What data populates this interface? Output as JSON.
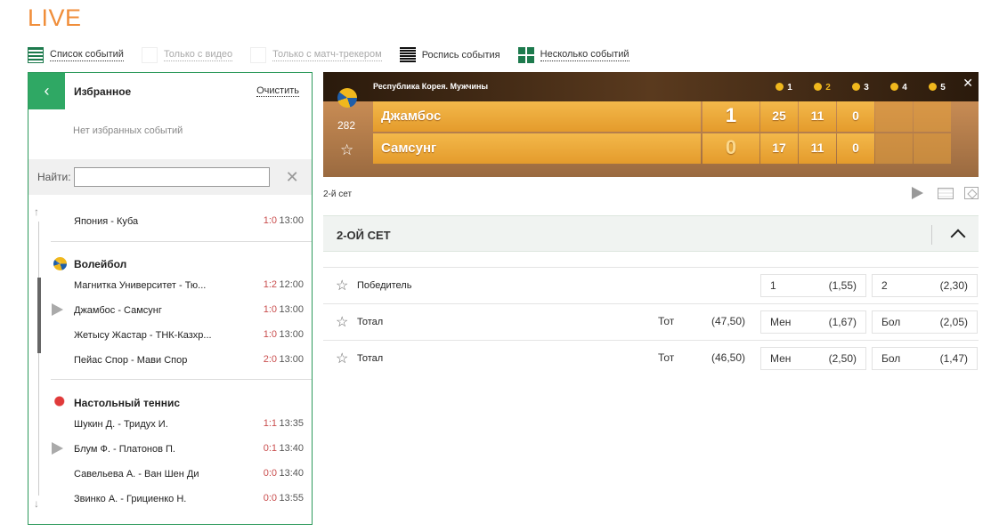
{
  "page_title": "LIVE",
  "view_options": [
    {
      "label": "Список событий",
      "icon": "list-icon"
    },
    {
      "label": "Только с видео",
      "icon": "video-filter-icon"
    },
    {
      "label": "Только с матч-трекером",
      "icon": "tracker-filter-icon"
    },
    {
      "label": "Роспись события",
      "icon": "event-detail-icon"
    },
    {
      "label": "Несколько событий",
      "icon": "multi-event-icon"
    }
  ],
  "favorites": {
    "title": "Избранное",
    "clear_label": "Очистить",
    "empty_text": "Нет избранных событий",
    "back_icon": "chevron-left-icon"
  },
  "search": {
    "label": "Найти:",
    "value": "",
    "clear_icon": "close-icon"
  },
  "events": {
    "top": [
      {
        "name": "Япония - Куба",
        "score": "1:0",
        "time": "13:00"
      }
    ],
    "volleyball": {
      "title": "Волейбол",
      "icon": "volleyball-icon",
      "rows": [
        {
          "name": "Магнитка Университет - Тю...",
          "score": "1:2",
          "time": "12:00"
        },
        {
          "name": "Джамбос - Самсунг",
          "score": "1:0",
          "time": "13:00",
          "video": true
        },
        {
          "name": "Жетысу Жастар - ТНК-Казхр...",
          "score": "1:0",
          "time": "13:00"
        },
        {
          "name": "Пейас Спор - Мави Спор",
          "score": "2:0",
          "time": "13:00"
        }
      ]
    },
    "table_tennis": {
      "title": "Настольный теннис",
      "icon": "table-tennis-icon",
      "rows": [
        {
          "name": "Шукин Д. - Тридух И.",
          "score": "1:1",
          "time": "13:35"
        },
        {
          "name": "Блум Ф. - Платонов П.",
          "score": "0:1",
          "time": "13:40",
          "video": true
        },
        {
          "name": "Савельева А. - Ван Шен Ди",
          "score": "0:0",
          "time": "13:40"
        },
        {
          "name": "Звинко А. - Грициенко Н.",
          "score": "0:0",
          "time": "13:55"
        }
      ]
    }
  },
  "scoreboard": {
    "tournament": "Республика Корея. Мужчины",
    "event_id": "282",
    "set_headers": [
      "1",
      "2",
      "3",
      "4",
      "5"
    ],
    "active_set": 2,
    "teams": [
      {
        "name": "Джамбос",
        "score": "1",
        "sets": [
          "25",
          "11",
          "0",
          "",
          ""
        ]
      },
      {
        "name": "Самсунг",
        "score": "0",
        "sets": [
          "17",
          "11",
          "0",
          "",
          ""
        ]
      }
    ]
  },
  "current_set_label": "2-й сет",
  "section_title": "2-ОЙ СЕТ",
  "markets": [
    {
      "name": "Победитель",
      "line_label": "",
      "line_value": "",
      "odds": [
        {
          "label": "1",
          "value": "(1,55)"
        },
        {
          "label": "2",
          "value": "(2,30)"
        }
      ]
    },
    {
      "name": "Тотал",
      "line_label": "Тот",
      "line_value": "(47,50)",
      "odds": [
        {
          "label": "Мен",
          "value": "(1,67)"
        },
        {
          "label": "Бол",
          "value": "(2,05)"
        }
      ]
    },
    {
      "name": "Тотал",
      "line_label": "Тот",
      "line_value": "(46,50)",
      "odds": [
        {
          "label": "Мен",
          "value": "(2,50)"
        },
        {
          "label": "Бол",
          "value": "(1,47)"
        }
      ]
    }
  ],
  "colors": {
    "accent_orange": "#f08e3a",
    "brand_green": "#2fa864",
    "score_red": "#c94d4d"
  }
}
